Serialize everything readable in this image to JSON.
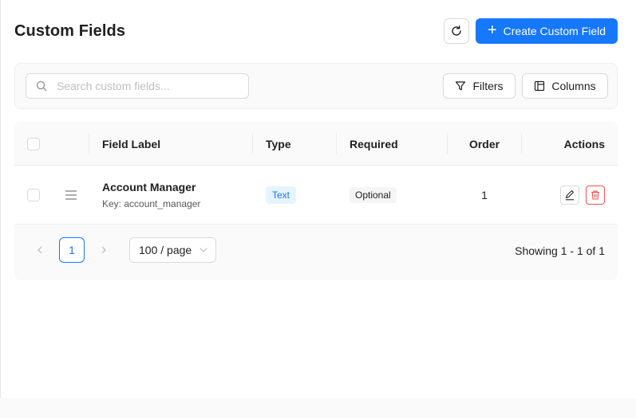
{
  "header": {
    "title": "Custom Fields",
    "refresh_icon": "refresh-icon",
    "create_button_label": "Create Custom Field",
    "create_icon": "plus-icon"
  },
  "toolbar": {
    "search_placeholder": "Search custom fields...",
    "search_value": "",
    "filters_label": "Filters",
    "columns_label": "Columns"
  },
  "table": {
    "columns": [
      "Field Label",
      "Type",
      "Required",
      "Order",
      "Actions"
    ],
    "rows": [
      {
        "label": "Account Manager",
        "key": "Key: account_manager",
        "type": "Text",
        "required": "Optional",
        "order": "1",
        "actions": [
          "edit-icon",
          "delete-icon"
        ]
      }
    ]
  },
  "pagination": {
    "current_page": "1",
    "page_size": "100 / page",
    "showing": "Showing 1 - 1 of 1"
  },
  "colors": {
    "accent": "#1677ff",
    "danger": "#ff4d4f",
    "type_tag_bg": "#e6f4ff",
    "required_tag_bg": "#f5f5f5"
  }
}
